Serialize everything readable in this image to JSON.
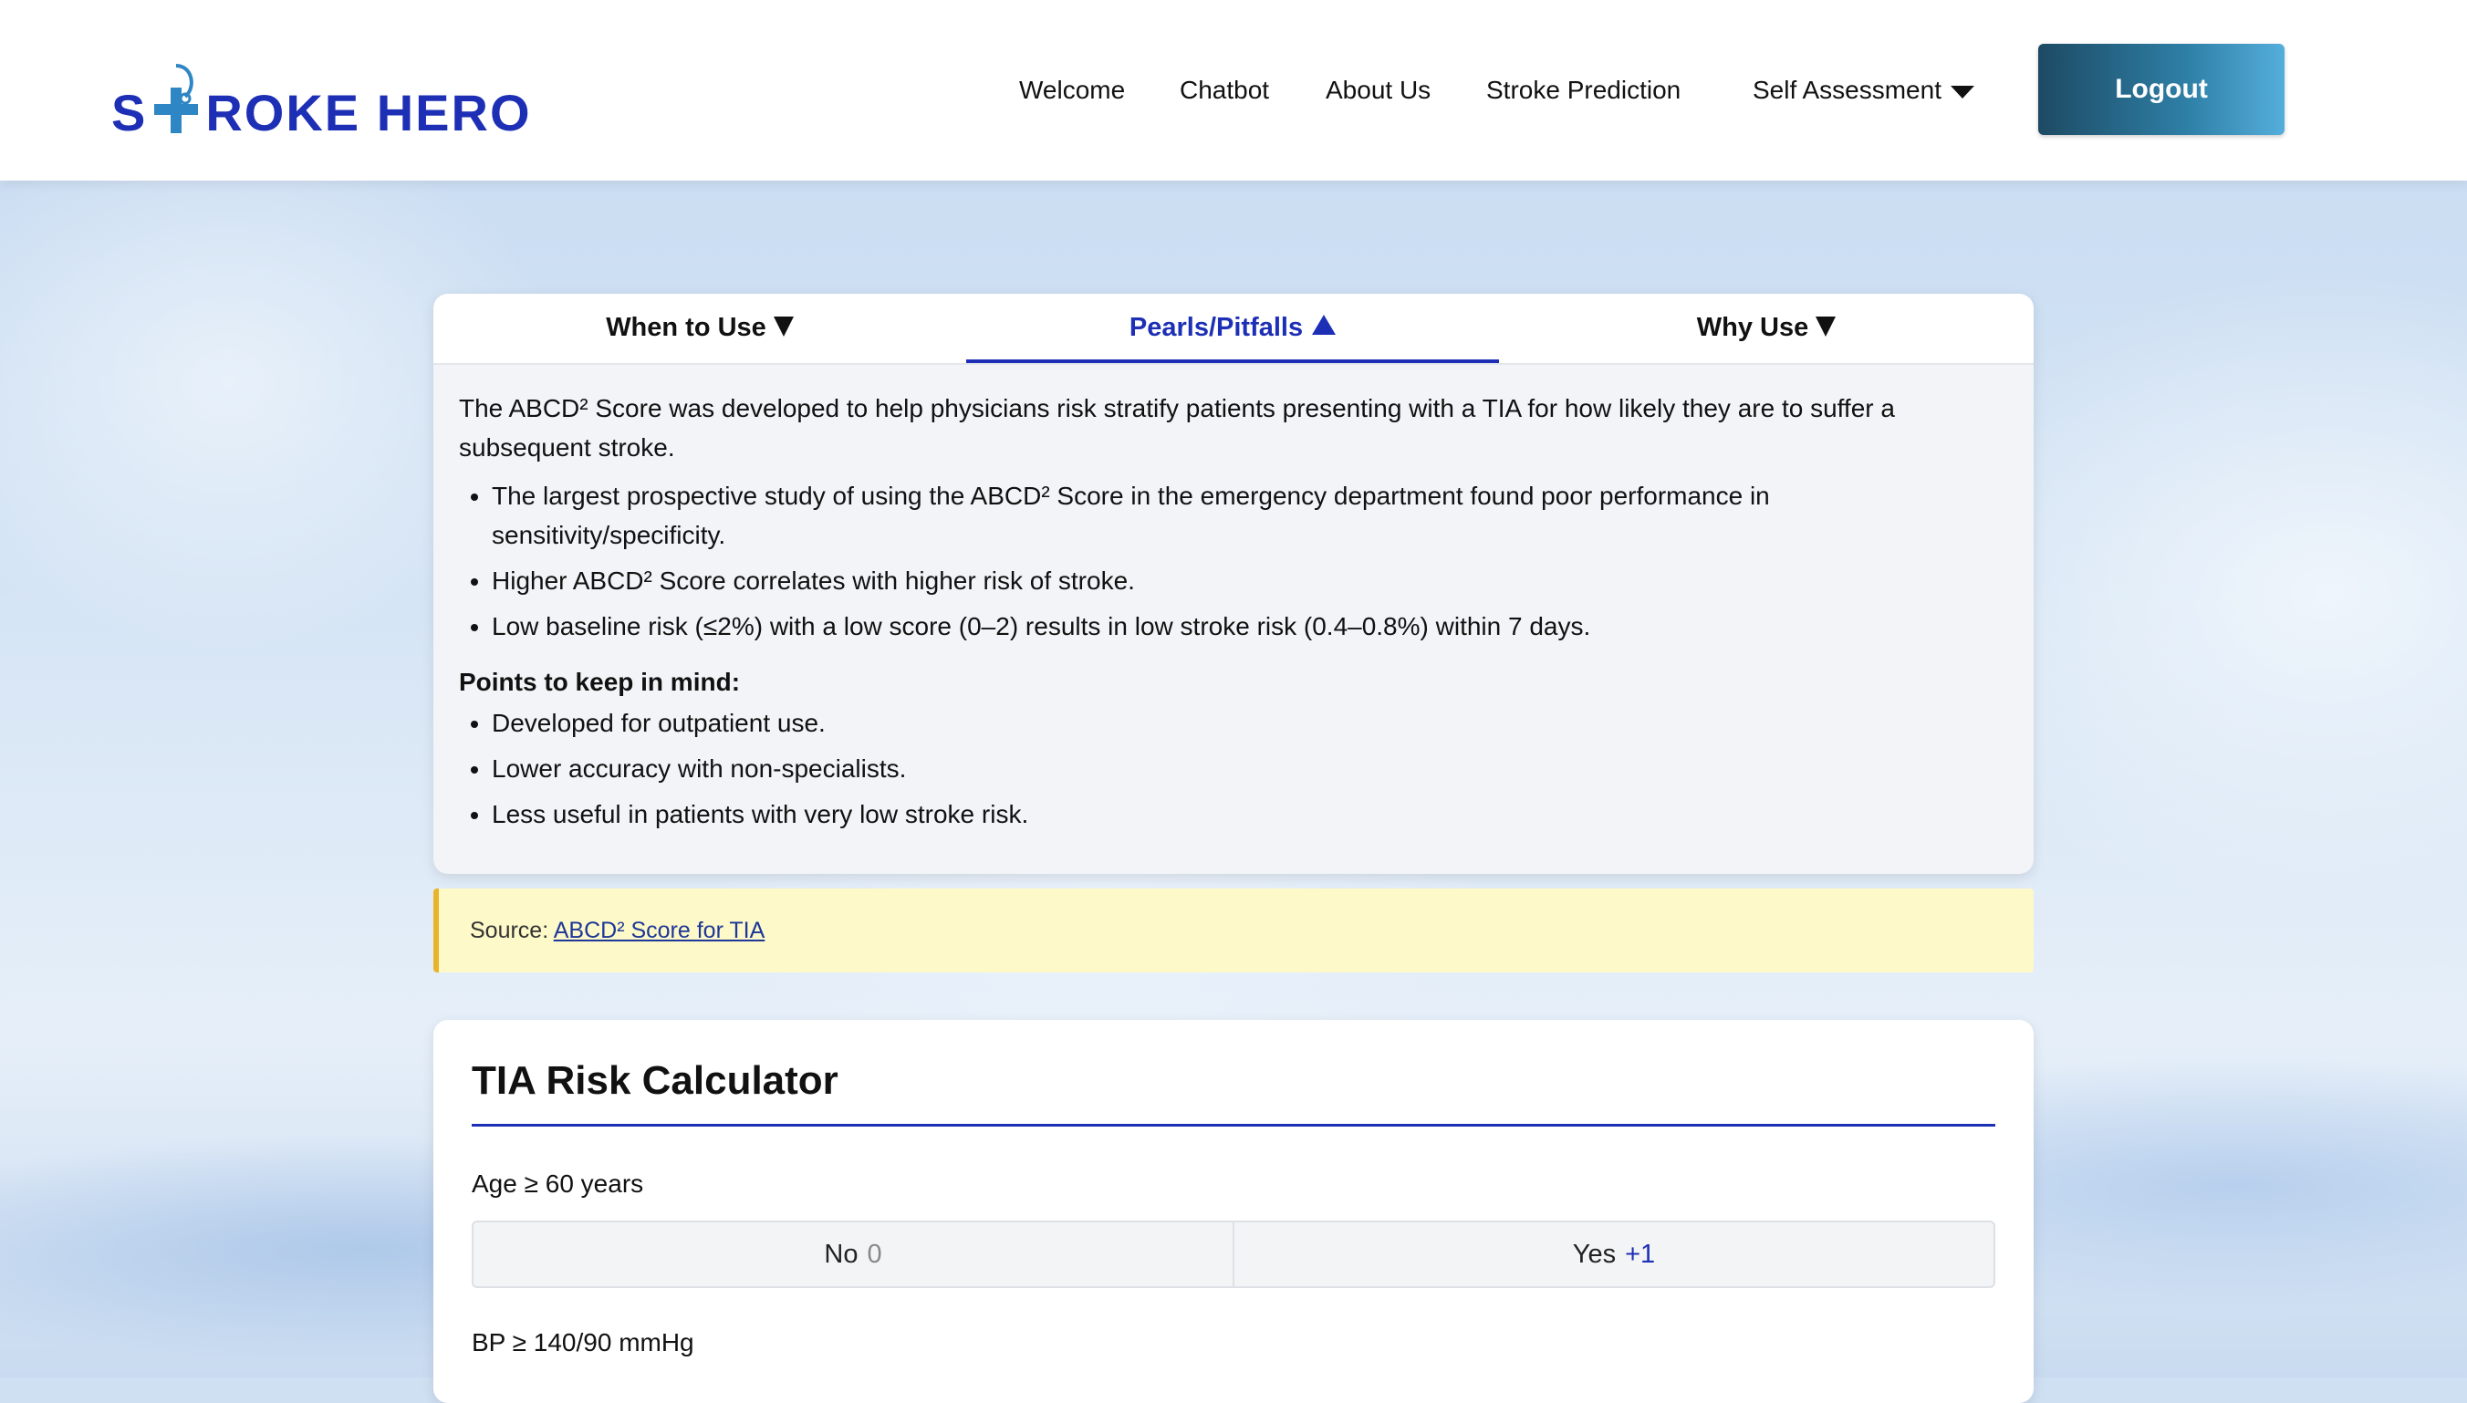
{
  "header": {
    "logo": {
      "before": "S",
      "after": "ROKE HERO"
    },
    "nav": [
      {
        "label": "Welcome"
      },
      {
        "label": "Chatbot"
      },
      {
        "label": "About Us"
      },
      {
        "label": "Stroke Prediction"
      },
      {
        "label": "Self Assessment"
      }
    ],
    "logout_label": "Logout"
  },
  "tabs": [
    {
      "label": "When to Use",
      "active": false
    },
    {
      "label": "Pearls/Pitfalls",
      "active": true
    },
    {
      "label": "Why Use",
      "active": false
    }
  ],
  "pearls": {
    "intro": "The ABCD² Score was developed to help physicians risk stratify patients presenting with a TIA for how likely they are to suffer a subsequent stroke.",
    "bullets": [
      "The largest prospective study of using the ABCD² Score in the emergency department found poor performance in sensitivity/specificity.",
      "Higher ABCD² Score correlates with higher risk of stroke.",
      "Low baseline risk (≤2%) with a low score (0–2) results in low stroke risk (0.4–0.8%) within 7 days."
    ],
    "points_heading": "Points to keep in mind:",
    "points": [
      "Developed for outpatient use.",
      "Lower accuracy with non-specialists.",
      "Less useful in patients with very low stroke risk."
    ]
  },
  "source": {
    "prefix": "Source: ",
    "link_text": "ABCD² Score for TIA"
  },
  "calculator": {
    "title": "TIA Risk Calculator",
    "questions": [
      {
        "label": "Age ≥ 60 years",
        "options": [
          {
            "label": "No",
            "points": "0"
          },
          {
            "label": "Yes",
            "points": "+1"
          }
        ]
      },
      {
        "label": "BP ≥ 140/90 mmHg"
      }
    ]
  },
  "colors": {
    "brand": "#1d2fb5",
    "source_bg": "#fdf9c8",
    "source_accent": "#e9b429"
  }
}
